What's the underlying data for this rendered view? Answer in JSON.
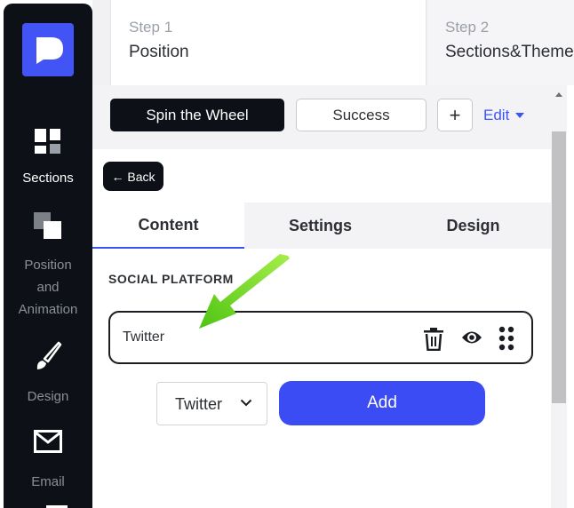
{
  "sidebar": {
    "items": [
      {
        "label": "Sections",
        "icon": "sections-icon",
        "active": true
      },
      {
        "label": "Position and Animation",
        "icon": "position-icon",
        "active": false
      },
      {
        "label": "Design",
        "icon": "brush-icon",
        "active": false
      },
      {
        "label": "Email",
        "icon": "mail-icon",
        "active": false
      }
    ]
  },
  "steps": [
    {
      "number": "Step 1",
      "name": "Position"
    },
    {
      "number": "Step 2",
      "name": "Sections&Theme"
    }
  ],
  "toolbar": {
    "spin_label": "Spin the Wheel",
    "success_label": "Success",
    "plus_label": "+",
    "edit_label": "Edit"
  },
  "panel": {
    "back_label": "← Back",
    "tabs": [
      {
        "label": "Content",
        "active": true
      },
      {
        "label": "Settings",
        "active": false
      },
      {
        "label": "Design",
        "active": false
      }
    ],
    "section_title": "SOCIAL PLATFORM",
    "platform_row": {
      "name": "Twitter",
      "icons": [
        "trash-icon",
        "eye-icon",
        "drag-handle-icon"
      ]
    },
    "select_value": "Twitter",
    "add_label": "Add"
  },
  "colors": {
    "accent": "#3b4cf5",
    "sidebar": "#0d1117",
    "arrow": "#6cd21f"
  }
}
